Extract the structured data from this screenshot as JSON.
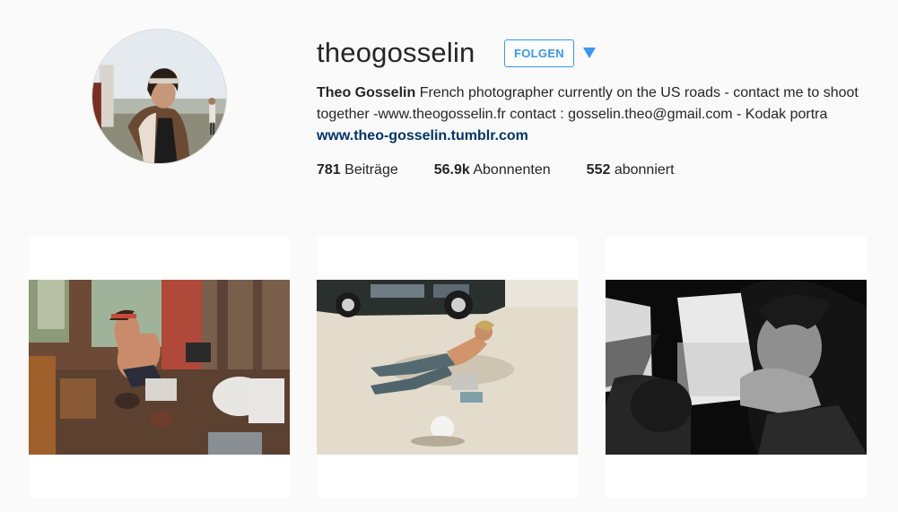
{
  "profile": {
    "username": "theogosselin",
    "follow_label": "FOLGEN",
    "bio": {
      "name": "Theo Gosselin",
      "text": "French photographer currently on the US roads - contact me to shoot together -www.theogosselin.fr contact : gosselin.theo@gmail.com - Kodak portra",
      "link": "www.theo-gosselin.tumblr.com"
    },
    "stats": [
      {
        "count": "781",
        "label": "Beiträge"
      },
      {
        "count": "56.9k",
        "label": "Abonnenten"
      },
      {
        "count": "552",
        "label": "abonniert"
      }
    ]
  },
  "icons": {
    "avatar": "profile-avatar",
    "caret": "dropdown-caret-icon"
  },
  "colors": {
    "accent": "#3897f0",
    "link": "#003569",
    "background": "#fafafa"
  }
}
